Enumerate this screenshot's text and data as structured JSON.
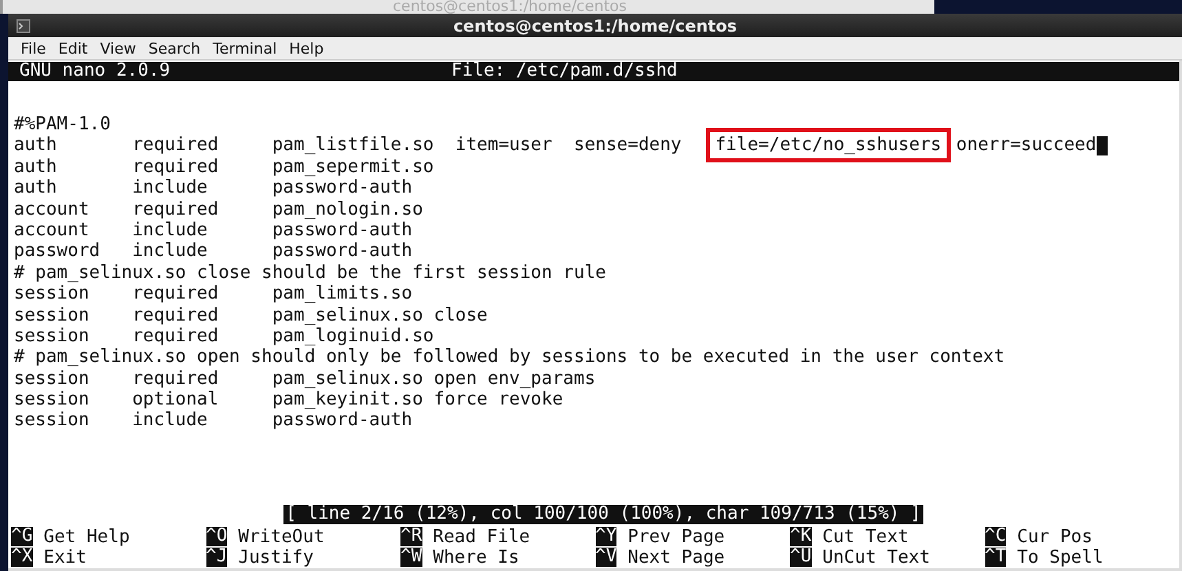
{
  "background_window": {
    "title": "centos@centos1:/home/centos"
  },
  "window": {
    "title": "centos@centos1:/home/centos"
  },
  "menu": [
    "File",
    "Edit",
    "View",
    "Search",
    "Terminal",
    "Help"
  ],
  "nano_header": {
    "version": "GNU nano 2.0.9",
    "file": "File: /etc/pam.d/sshd"
  },
  "lines": [
    {
      "segments": [
        {
          "text": "#%PAM-1.0",
          "boxed": false
        }
      ],
      "cursor": false
    },
    {
      "segments": [
        {
          "text": "auth       required     pam_listfile.so  item=user  sense=deny   ",
          "boxed": false
        },
        {
          "text": "file=/etc/no_sshusers",
          "boxed": true
        },
        {
          "text": " onerr=succeed",
          "boxed": false
        }
      ],
      "cursor": true
    },
    {
      "segments": [
        {
          "text": "auth       required     pam_sepermit.so",
          "boxed": false
        }
      ],
      "cursor": false
    },
    {
      "segments": [
        {
          "text": "auth       include      password-auth",
          "boxed": false
        }
      ],
      "cursor": false
    },
    {
      "segments": [
        {
          "text": "account    required     pam_nologin.so",
          "boxed": false
        }
      ],
      "cursor": false
    },
    {
      "segments": [
        {
          "text": "account    include      password-auth",
          "boxed": false
        }
      ],
      "cursor": false
    },
    {
      "segments": [
        {
          "text": "password   include      password-auth",
          "boxed": false
        }
      ],
      "cursor": false
    },
    {
      "segments": [
        {
          "text": "# pam_selinux.so close should be the first session rule",
          "boxed": false
        }
      ],
      "cursor": false
    },
    {
      "segments": [
        {
          "text": "session    required     pam_limits.so",
          "boxed": false
        }
      ],
      "cursor": false
    },
    {
      "segments": [
        {
          "text": "session    required     pam_selinux.so close",
          "boxed": false
        }
      ],
      "cursor": false
    },
    {
      "segments": [
        {
          "text": "session    required     pam_loginuid.so",
          "boxed": false
        }
      ],
      "cursor": false
    },
    {
      "segments": [
        {
          "text": "# pam_selinux.so open should only be followed by sessions to be executed in the user context",
          "boxed": false
        }
      ],
      "cursor": false
    },
    {
      "segments": [
        {
          "text": "session    required     pam_selinux.so open env_params",
          "boxed": false
        }
      ],
      "cursor": false
    },
    {
      "segments": [
        {
          "text": "session    optional     pam_keyinit.so force revoke",
          "boxed": false
        }
      ],
      "cursor": false
    },
    {
      "segments": [
        {
          "text": "session    include      password-auth",
          "boxed": false
        }
      ],
      "cursor": false
    }
  ],
  "status": "[ line 2/16 (12%), col 100/100 (100%), char 109/713 (15%) ]",
  "shortcuts": [
    [
      {
        "key": "^G",
        "label": "Get Help"
      },
      {
        "key": "^X",
        "label": "Exit"
      }
    ],
    [
      {
        "key": "^O",
        "label": "WriteOut"
      },
      {
        "key": "^J",
        "label": "Justify"
      }
    ],
    [
      {
        "key": "^R",
        "label": "Read File"
      },
      {
        "key": "^W",
        "label": "Where Is"
      }
    ],
    [
      {
        "key": "^Y",
        "label": "Prev Page"
      },
      {
        "key": "^V",
        "label": "Next Page"
      }
    ],
    [
      {
        "key": "^K",
        "label": "Cut Text"
      },
      {
        "key": "^U",
        "label": "UnCut Text"
      }
    ],
    [
      {
        "key": "^C",
        "label": "Cur Pos"
      },
      {
        "key": "^T",
        "label": "To Spell"
      }
    ]
  ]
}
